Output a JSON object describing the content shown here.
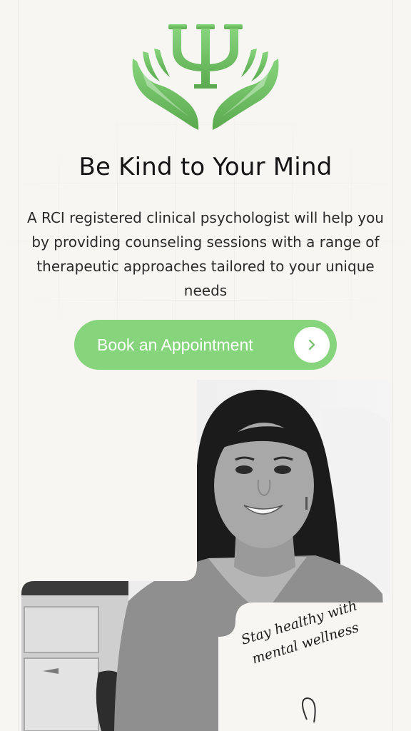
{
  "hero": {
    "logo_icon": "psi-hands-icon",
    "title": "Be Kind to Your Mind",
    "description": "A RCI registered clinical psychologist will help you by providing counseling sessions with a range of therapeutic approaches tailored to your unique needs"
  },
  "cta": {
    "label": "Book an Appointment",
    "icon": "chevron-right-icon"
  },
  "photo_card": {
    "tagline": "Stay healthy with mental wellness"
  },
  "colors": {
    "accent": "#86d57c",
    "accent_dark": "#5aa94f",
    "background": "#f7f6f2",
    "text": "#1d1d1d"
  }
}
